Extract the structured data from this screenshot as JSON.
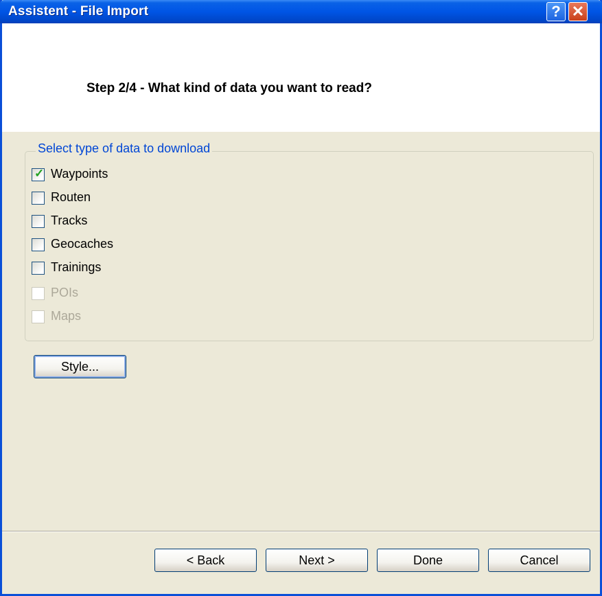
{
  "window": {
    "title": "Assistent - File Import",
    "help_glyph": "?",
    "close_glyph": "✕",
    "accent": "#0055e5",
    "close_color": "#c9401a"
  },
  "header": {
    "title": "Step 2/4 - What kind of data you want to read?"
  },
  "group": {
    "legend": "Select type of data to download",
    "items": [
      {
        "label": "Waypoints",
        "checked": true,
        "enabled": true
      },
      {
        "label": "Routen",
        "checked": false,
        "enabled": true
      },
      {
        "label": "Tracks",
        "checked": false,
        "enabled": true
      },
      {
        "label": "Geocaches",
        "checked": false,
        "enabled": true
      },
      {
        "label": "Trainings",
        "checked": false,
        "enabled": true
      },
      {
        "label": "POIs",
        "checked": false,
        "enabled": false
      },
      {
        "label": "Maps",
        "checked": false,
        "enabled": false
      }
    ]
  },
  "style_button": "Style...",
  "footer": {
    "back": "< Back",
    "next": "Next >",
    "done": "Done",
    "cancel": "Cancel"
  }
}
